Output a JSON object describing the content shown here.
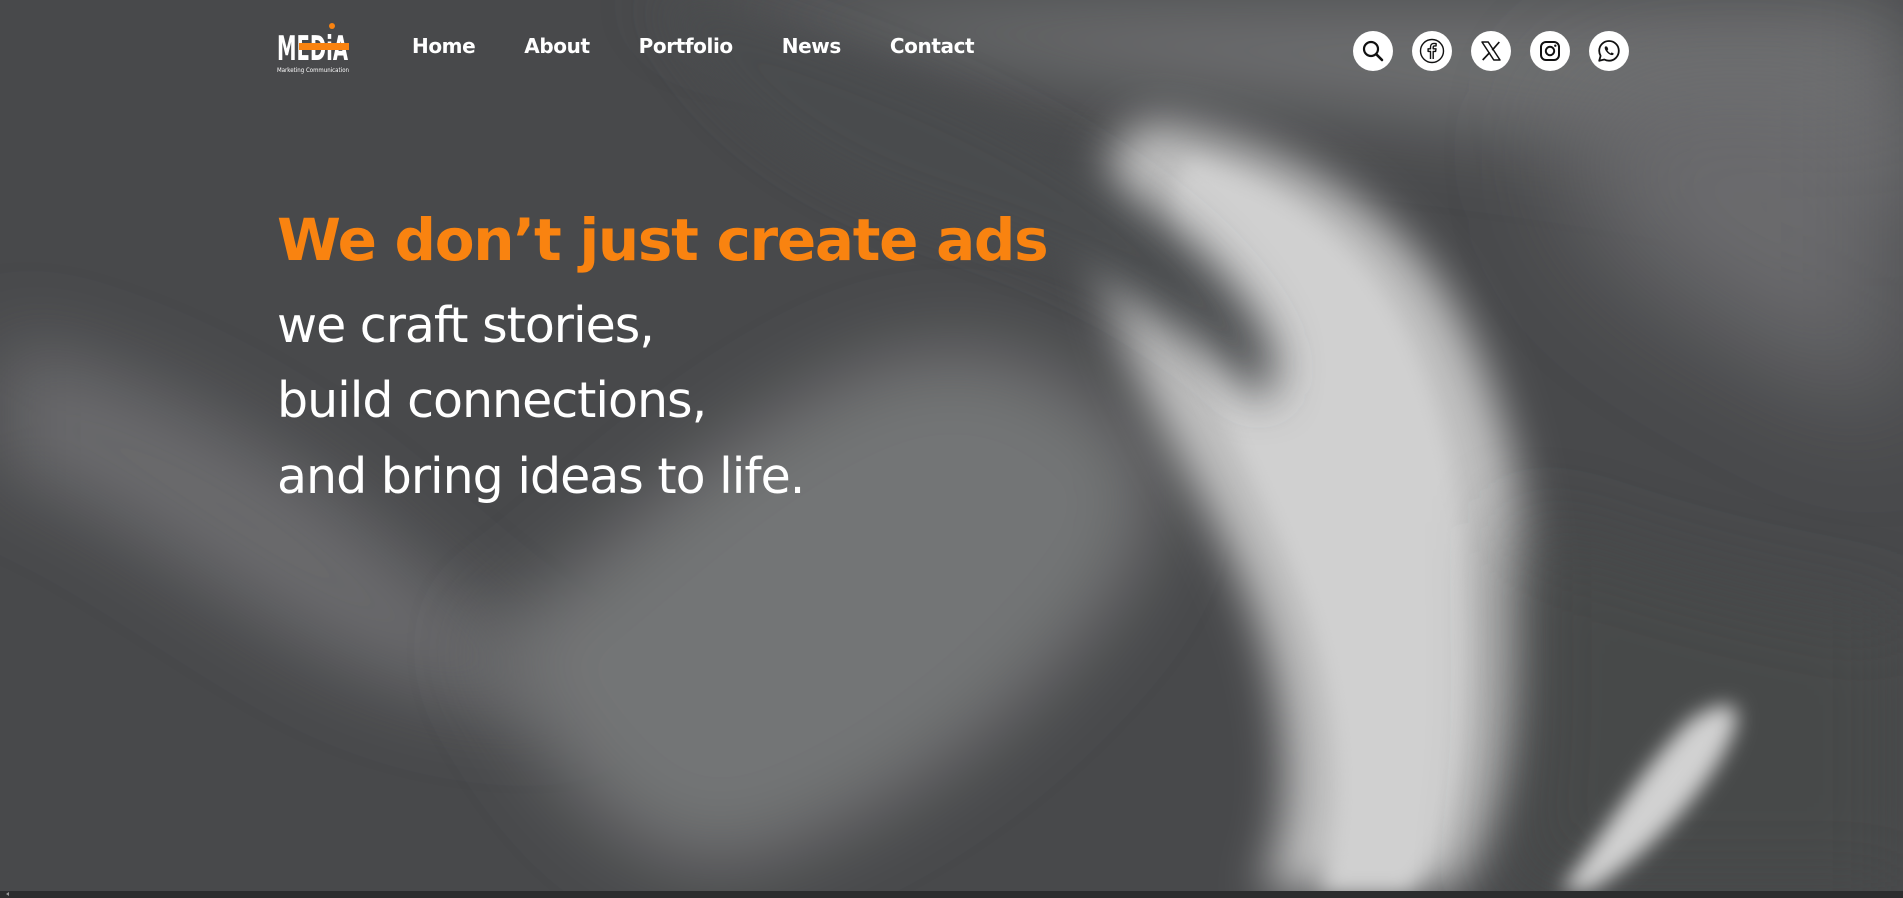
{
  "brand": {
    "logo_text": "MEDiA",
    "logo_tagline": "Marketing  Communication",
    "accent_color": "#f98310",
    "text_color": "#ffffff",
    "background_color": "#48494b"
  },
  "nav": {
    "items": [
      {
        "label": "Home"
      },
      {
        "label": "About"
      },
      {
        "label": "Portfolio"
      },
      {
        "label": "News"
      },
      {
        "label": "Contact"
      }
    ]
  },
  "header_icons": [
    {
      "icon": "search-icon"
    },
    {
      "icon": "facebook-icon"
    },
    {
      "icon": "x-twitter-icon"
    },
    {
      "icon": "instagram-icon"
    },
    {
      "icon": "whatsapp-icon"
    }
  ],
  "hero": {
    "headline": "We don’t just create ads",
    "lines": [
      "we craft stories,",
      "build connections,",
      "and bring ideas to life."
    ]
  }
}
